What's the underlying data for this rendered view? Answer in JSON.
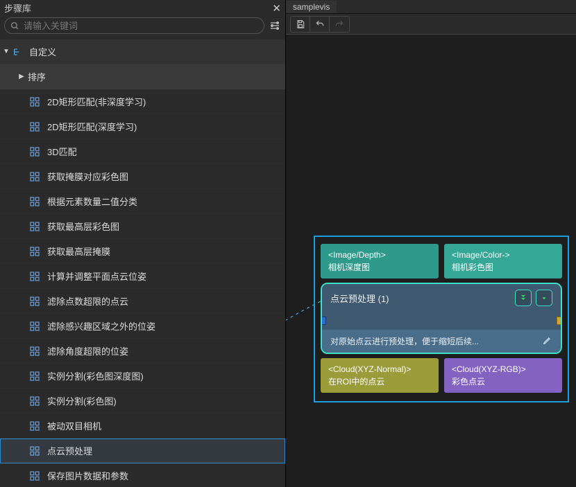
{
  "left": {
    "title": "步骤库",
    "search_placeholder": "请输入关键词",
    "root": "自定义",
    "sort_header": "排序",
    "items": [
      "2D矩形匹配(非深度学习)",
      "2D矩形匹配(深度学习)",
      "3D匹配",
      "获取掩膜对应彩色图",
      "根据元素数量二值分类",
      "获取最高层彩色图",
      "获取最高层掩膜",
      "计算并调整平面点云位姿",
      "滤除点数超限的点云",
      "滤除感兴趣区域之外的位姿",
      "滤除角度超限的位姿",
      "实例分割(彩色图深度图)",
      "实例分割(彩色图)",
      "被动双目相机",
      "点云预处理",
      "保存图片数据和参数"
    ],
    "selected_index": 14
  },
  "right": {
    "tab": "samplevis",
    "node": {
      "inputs": [
        {
          "type": "<Image/Depth>",
          "label": "相机深度图",
          "style": "teal"
        },
        {
          "type": "<Image/Color->",
          "label": "相机彩色图",
          "style": "teal2"
        }
      ],
      "title": "点云预处理 (1)",
      "desc": "对原始点云进行预处理，便于缩短后续...",
      "outputs": [
        {
          "type": "<Cloud(XYZ-Normal)>",
          "label": "在ROI中的点云",
          "style": "olive"
        },
        {
          "type": "<Cloud(XYZ-RGB)>",
          "label": "彩色点云",
          "style": "purple"
        }
      ]
    }
  }
}
